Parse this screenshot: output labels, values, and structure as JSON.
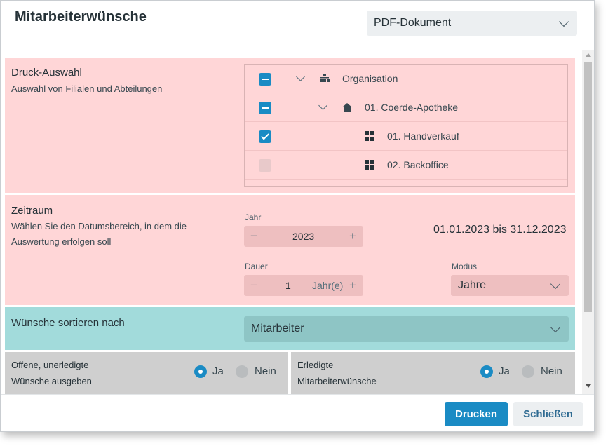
{
  "dialog": {
    "title": "Mitarbeiterwünsche",
    "format_select": "PDF-Dokument"
  },
  "druck_auswahl": {
    "title": "Druck-Auswahl",
    "description": "Auswahl von Filialen und Abteilungen",
    "tree": [
      {
        "label": "Organisation",
        "state": "indeterminate",
        "expanded": true,
        "icon": "organisation-icon"
      },
      {
        "label": "01. Coerde-Apotheke",
        "state": "indeterminate",
        "expanded": true,
        "icon": "home-icon"
      },
      {
        "label": "01. Handverkauf",
        "state": "checked",
        "icon": "department-icon"
      },
      {
        "label": "02. Backoffice",
        "state": "unchecked",
        "icon": "department-icon"
      }
    ]
  },
  "zeitraum": {
    "title": "Zeitraum",
    "description_line1": "Wählen Sie den Datumsbereich, in dem die",
    "description_line2": "Auswertung erfolgen soll",
    "jahr_label": "Jahr",
    "jahr_value": "2023",
    "date_range": "01.01.2023 bis 31.12.2023",
    "dauer_label": "Dauer",
    "dauer_value": "1",
    "dauer_unit": "Jahr(e)",
    "modus_label": "Modus",
    "modus_value": "Jahre",
    "minus": "−",
    "plus": "+"
  },
  "sortierung": {
    "title": "Wünsche sortieren nach",
    "value": "Mitarbeiter"
  },
  "offene": {
    "label_line1": "Offene, unerledigte",
    "label_line2": "Wünsche ausgeben",
    "option_yes": "Ja",
    "option_no": "Nein",
    "selected": "Ja"
  },
  "erledigte": {
    "label_line1": "Erledigte",
    "label_line2": "Mitarbeiterwünsche",
    "option_yes": "Ja",
    "option_no": "Nein",
    "selected": "Ja"
  },
  "footer": {
    "print_label": "Drucken",
    "close_label": "Schließen"
  },
  "colors": {
    "accent": "#1a8bc4",
    "section_red": "#ffd6d7",
    "section_teal": "#a2dbdb",
    "section_grey": "#cfcfcf"
  }
}
